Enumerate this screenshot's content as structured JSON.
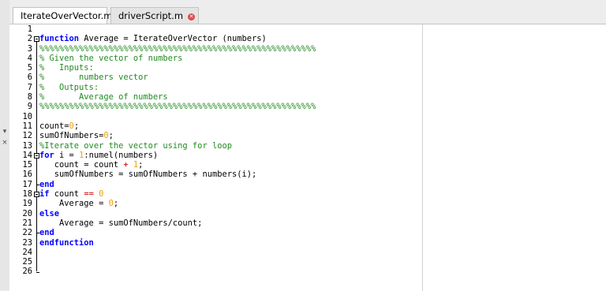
{
  "tabs": [
    {
      "label": "IterateOverVector.m",
      "close_icon": "close-icon",
      "active": true
    },
    {
      "label": "driverScript.m",
      "close_icon": "close-icon",
      "active": false
    }
  ],
  "side_icons": [
    "▾",
    "×"
  ],
  "lines": [
    {
      "n": "1",
      "tokens": []
    },
    {
      "n": "2",
      "tokens": [
        [
          "kw",
          "function"
        ],
        [
          "pl",
          " Average = IterateOverVector (numbers)"
        ]
      ]
    },
    {
      "n": "3",
      "tokens": [
        [
          "cm",
          "%%%%%%%%%%%%%%%%%%%%%%%%%%%%%%%%%%%%%%%%%%%%%%%%%%%%%%%%"
        ]
      ]
    },
    {
      "n": "4",
      "tokens": [
        [
          "cm",
          "% Given the vector of numbers"
        ]
      ]
    },
    {
      "n": "5",
      "tokens": [
        [
          "cm",
          "%   Inputs:"
        ]
      ]
    },
    {
      "n": "6",
      "tokens": [
        [
          "cm",
          "%       numbers vector"
        ]
      ]
    },
    {
      "n": "7",
      "tokens": [
        [
          "cm",
          "%   Outputs:"
        ]
      ]
    },
    {
      "n": "8",
      "tokens": [
        [
          "cm",
          "%       Average of numbers"
        ]
      ]
    },
    {
      "n": "9",
      "tokens": [
        [
          "cm",
          "%%%%%%%%%%%%%%%%%%%%%%%%%%%%%%%%%%%%%%%%%%%%%%%%%%%%%%%%"
        ]
      ]
    },
    {
      "n": "10",
      "tokens": []
    },
    {
      "n": "11",
      "tokens": [
        [
          "pl",
          "count="
        ],
        [
          "num",
          "0"
        ],
        [
          "pl",
          ";"
        ]
      ]
    },
    {
      "n": "12",
      "tokens": [
        [
          "pl",
          "sumOfNumbers="
        ],
        [
          "num",
          "0"
        ],
        [
          "pl",
          ";"
        ]
      ]
    },
    {
      "n": "13",
      "tokens": [
        [
          "cm",
          "%Iterate over the vector using for loop"
        ]
      ]
    },
    {
      "n": "14",
      "tokens": [
        [
          "kw",
          "for"
        ],
        [
          "pl",
          " i = "
        ],
        [
          "num",
          "1"
        ],
        [
          "pl",
          ":numel(numbers)"
        ]
      ]
    },
    {
      "n": "15",
      "tokens": [
        [
          "pl",
          "   count = count "
        ],
        [
          "op",
          "+"
        ],
        [
          "pl",
          " "
        ],
        [
          "num",
          "1"
        ],
        [
          "pl",
          ";"
        ]
      ]
    },
    {
      "n": "16",
      "tokens": [
        [
          "pl",
          "   sumOfNumbers = sumOfNumbers + numbers(i);"
        ]
      ]
    },
    {
      "n": "17",
      "tokens": [
        [
          "kw",
          "end"
        ]
      ]
    },
    {
      "n": "18",
      "tokens": [
        [
          "kw",
          "if"
        ],
        [
          "pl",
          " count "
        ],
        [
          "op",
          "=="
        ],
        [
          "pl",
          " "
        ],
        [
          "num",
          "0"
        ]
      ]
    },
    {
      "n": "19",
      "tokens": [
        [
          "pl",
          "    Average = "
        ],
        [
          "num",
          "0"
        ],
        [
          "pl",
          ";"
        ]
      ]
    },
    {
      "n": "20",
      "tokens": [
        [
          "kw",
          "else"
        ]
      ]
    },
    {
      "n": "21",
      "tokens": [
        [
          "pl",
          "    Average = sumOfNumbers/count;"
        ]
      ]
    },
    {
      "n": "22",
      "tokens": [
        [
          "kw",
          "end"
        ]
      ]
    },
    {
      "n": "23",
      "tokens": [
        [
          "kw",
          "endfunction"
        ]
      ]
    },
    {
      "n": "24",
      "tokens": []
    },
    {
      "n": "25",
      "tokens": []
    },
    {
      "n": "26",
      "tokens": []
    }
  ],
  "colors": {
    "keyword": "#0000ff",
    "comment": "#228b22",
    "number": "#f0a000",
    "operator": "#cc0000"
  }
}
